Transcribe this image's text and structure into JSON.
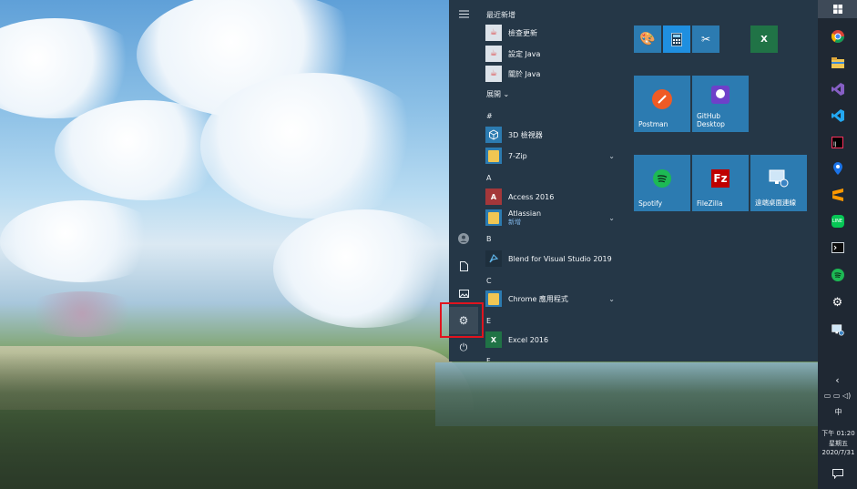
{
  "start_menu": {
    "recent_header": "最近新增",
    "recent_apps": [
      {
        "label": "檢查更新",
        "icon": "java-icon"
      },
      {
        "label": "設定 Java",
        "icon": "java-icon"
      },
      {
        "label": "關於 Java",
        "icon": "java-icon"
      }
    ],
    "expand_label": "展開",
    "groups": {
      "hash": "#",
      "a": "A",
      "b": "B",
      "c": "C",
      "e": "E",
      "f": "F"
    },
    "apps": {
      "viewer3d": "3D 檢視器",
      "sevenzip": "7-Zip",
      "access": "Access 2016",
      "atlassian": "Atlassian",
      "atlassian_sub": "新增",
      "blend": "Blend for Visual Studio 2019",
      "chrome_apps": "Chrome 應用程式",
      "excel": "Excel 2016"
    },
    "tiles": {
      "postman": "Postman",
      "github": "GitHub Desktop",
      "spotify": "Spotify",
      "filezilla": "FileZilla",
      "remote": "遠端桌面連線"
    },
    "colors": {
      "menu_bg": "#253747",
      "tile_bg": "#2c7bb1",
      "highlight": "#e0141e"
    }
  },
  "taskbar": {
    "time": "下午 01:20",
    "weekday": "星期五",
    "date": "2020/7/31",
    "ime": "中",
    "apps": [
      "windows-icon",
      "chrome-icon",
      "file-explorer-icon",
      "visual-studio-icon",
      "vscode-icon",
      "intellij-icon",
      "maps-icon",
      "sublime-icon",
      "line-icon",
      "terminal-icon",
      "spotify-icon",
      "settings-icon",
      "remote-desktop-icon"
    ]
  }
}
